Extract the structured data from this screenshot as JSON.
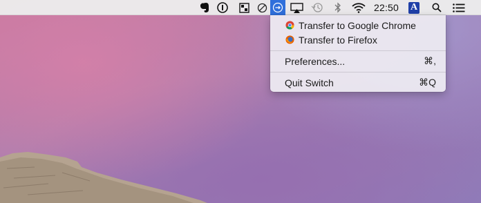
{
  "menubar": {
    "status_icons": [
      "evernote-icon",
      "1password-icon",
      "dashlane-icon",
      "do-not-disturb-icon",
      "switch-icon",
      "airplay-icon",
      "time-machine-icon",
      "bluetooth-icon",
      "wifi-icon"
    ],
    "clock": "22:50",
    "input_source": "A",
    "right_icons": [
      "spotlight-search-icon",
      "notification-center-icon"
    ]
  },
  "switch_menu": {
    "items": [
      {
        "label": "Transfer to Google Chrome",
        "icon": "chrome-icon"
      },
      {
        "label": "Transfer to Firefox",
        "icon": "firefox-icon"
      }
    ],
    "preferences": {
      "label": "Preferences...",
      "shortcut": "⌘,"
    },
    "quit": {
      "label": "Quit Switch",
      "shortcut": "⌘Q"
    }
  },
  "colors": {
    "menubar_bg": "#ececec",
    "active_status_item": "#2f6fdb",
    "input_badge": "#1f3fa8"
  }
}
